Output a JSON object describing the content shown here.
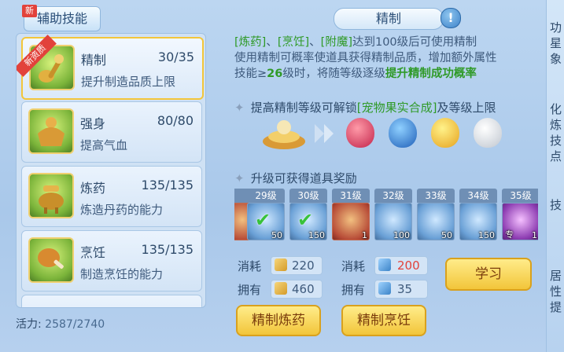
{
  "tab": {
    "label": "辅助技能",
    "badge": "新"
  },
  "skills": [
    {
      "name": "精制",
      "level": "30/35",
      "desc": "提升制造品质上限",
      "ribbon": "新资质",
      "selected": true
    },
    {
      "name": "强身",
      "level": "80/80",
      "desc": "提高气血"
    },
    {
      "name": "炼药",
      "level": "135/135",
      "desc": "炼造丹药的能力"
    },
    {
      "name": "烹饪",
      "level": "135/135",
      "desc": "制造烹饪的能力"
    }
  ],
  "vitality": {
    "label": "活力:",
    "value": "2587/2740"
  },
  "panel": {
    "title": "精制",
    "help": "!",
    "desc": {
      "p1": "[炼药]",
      "p2": "、",
      "p3": "[烹饪]",
      "p4": "、",
      "p5": "[附魔]",
      "p6": "达到100级后可使用精制",
      "line2": "使用精制可概率使道具获得精制品质，增加额外属性",
      "line3a": "技能≥",
      "line3b": "26",
      "line3c": "级时，将随等级逐级",
      "line3d": "提升精制成功概率"
    },
    "section1": {
      "a": "提高精制等级可解锁",
      "b": "[宠物果实合成]",
      "c": "及等级上限"
    },
    "section2": {
      "title": "升级可获得道具奖励"
    },
    "rewards": [
      {
        "level": "29级",
        "count": "50",
        "claimed": true
      },
      {
        "level": "30级",
        "count": "150",
        "claimed": true
      },
      {
        "level": "31级",
        "count": "1",
        "claimed": false
      },
      {
        "level": "32级",
        "count": "100",
        "claimed": false
      },
      {
        "level": "33级",
        "count": "50",
        "claimed": false
      },
      {
        "level": "34级",
        "count": "150",
        "claimed": false
      },
      {
        "level": "35级",
        "count": "1",
        "claimed": false,
        "tag": "专"
      }
    ],
    "partial_left": {
      "count": "1"
    },
    "costs": {
      "consume_label": "消耗",
      "own_label": "拥有",
      "coin_consume": "220",
      "coin_own": "460",
      "book_consume": "200",
      "book_own": "35"
    },
    "buttons": {
      "learn": "学习",
      "refine_drug": "精制炼药",
      "refine_cook": "精制烹饪"
    }
  },
  "edge": [
    "功",
    "星",
    "象",
    "化",
    "炼",
    "技",
    "点",
    "技",
    "居",
    "性",
    "提"
  ],
  "colors": {
    "accent_green": "#2f9a27",
    "danger_red": "#e2423b",
    "gold": "#f2c53a"
  }
}
